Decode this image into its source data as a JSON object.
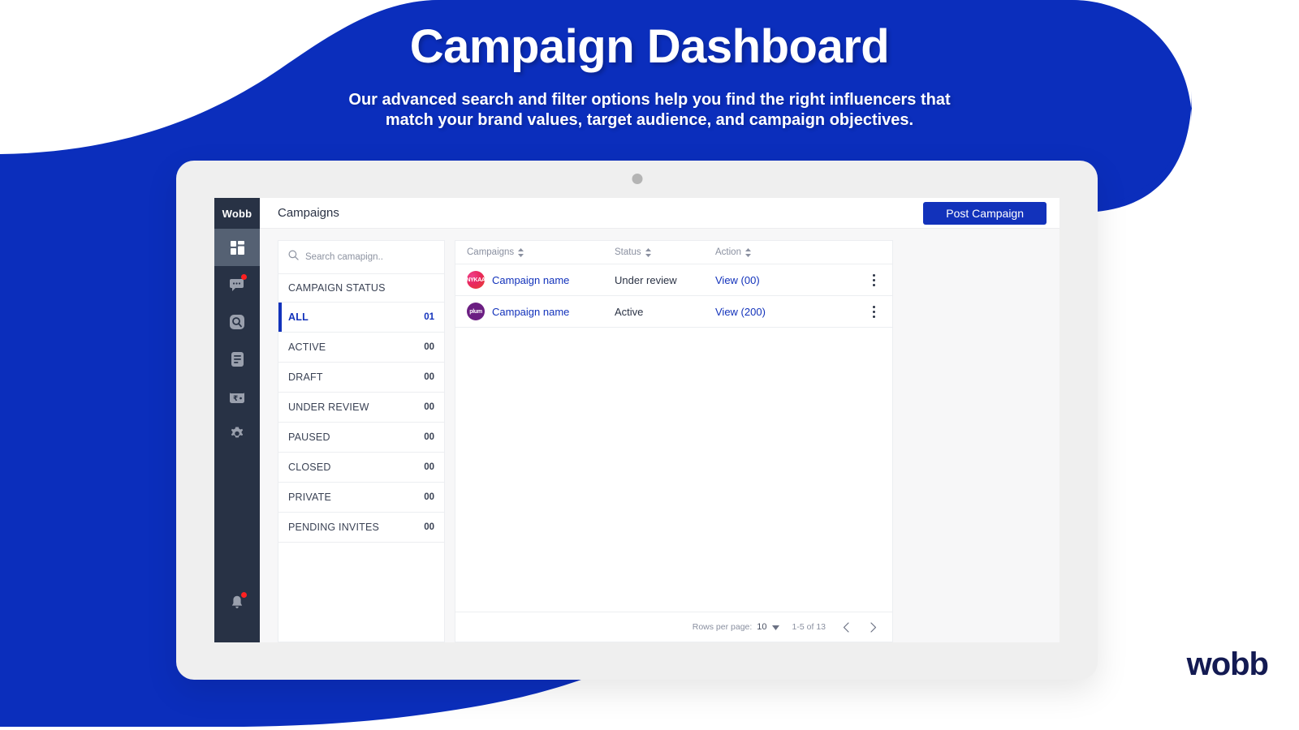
{
  "hero": {
    "title": "Campaign Dashboard",
    "subtitle_line1": "Our advanced search and filter options help you find the right influencers that",
    "subtitle_line2": "match your brand values, target audience, and campaign objectives."
  },
  "brand_footer": "wobb",
  "colors": {
    "brand_blue": "#1232bb",
    "background_blue": "#0b2ebc",
    "sidebar_navy": "#283245",
    "logo_navy": "#131a52",
    "badge_red": "#ff2020"
  },
  "app": {
    "sidebar": {
      "brand": "Wobb",
      "items": [
        {
          "name": "dashboard-icon",
          "label": "Dashboard",
          "active": true,
          "badge": false
        },
        {
          "name": "chat-icon",
          "label": "Messages",
          "active": false,
          "badge": true
        },
        {
          "name": "search-icon",
          "label": "Discover",
          "active": false,
          "badge": false
        },
        {
          "name": "document-icon",
          "label": "Reports",
          "active": false,
          "badge": false
        },
        {
          "name": "wallet-rupee-icon",
          "label": "Payments",
          "active": false,
          "badge": false
        },
        {
          "name": "gear-icon",
          "label": "Settings",
          "active": false,
          "badge": false
        }
      ],
      "bottom_item": {
        "name": "bell-icon",
        "label": "Notifications",
        "badge": true
      }
    },
    "topbar": {
      "title": "Campaigns",
      "post_button": "Post Campaign"
    },
    "filters": {
      "search_placeholder": "Search camapign..",
      "section_title": "CAMPAIGN STATUS",
      "items": [
        {
          "label": "ALL",
          "count": "01",
          "selected": true
        },
        {
          "label": "ACTIVE",
          "count": "00",
          "selected": false
        },
        {
          "label": "DRAFT",
          "count": "00",
          "selected": false
        },
        {
          "label": "UNDER REVIEW",
          "count": "00",
          "selected": false
        },
        {
          "label": "PAUSED",
          "count": "00",
          "selected": false
        },
        {
          "label": "CLOSED",
          "count": "00",
          "selected": false
        },
        {
          "label": "PRIVATE",
          "count": "00",
          "selected": false
        },
        {
          "label": "PENDING INVITES",
          "count": "00",
          "selected": false
        }
      ]
    },
    "table": {
      "columns": [
        {
          "label": "Campaigns",
          "sortable": true
        },
        {
          "label": "Status",
          "sortable": true
        },
        {
          "label": "Action",
          "sortable": true
        }
      ],
      "rows": [
        {
          "avatar": "nykaa-avatar",
          "avatar_text": "NYKAA",
          "campaign": "Campaign name",
          "status": "Under review",
          "action": "View (00)"
        },
        {
          "avatar": "plum-avatar",
          "avatar_text": "plum",
          "campaign": "Campaign name",
          "status": "Active",
          "action": "View (200)"
        }
      ],
      "footer": {
        "rows_per_page_label": "Rows per page:",
        "rows_per_page_value": "10",
        "range": "1-5 of 13"
      }
    }
  }
}
